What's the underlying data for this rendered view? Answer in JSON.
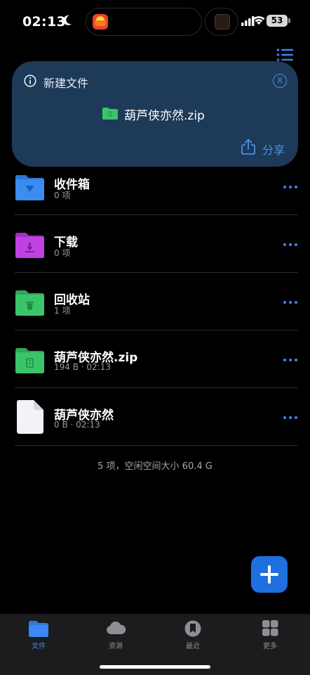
{
  "status_bar": {
    "time": "02:13",
    "battery": "53",
    "icons": [
      "moon-icon",
      "cellular-signal-icon",
      "wifi-icon",
      "battery-icon"
    ]
  },
  "toolbar": {
    "icon": "list-view-icon"
  },
  "banner": {
    "title": "新建文件",
    "file_name": "葫芦侠亦然.zip",
    "share_label": "分享",
    "icons": [
      "info-icon",
      "close-icon",
      "folder-icon",
      "share-icon"
    ],
    "background": "#1d3a58",
    "accent": "#4a90e8"
  },
  "files": [
    {
      "name": "收件箱",
      "meta": "0 项",
      "icon": "inbox-folder-icon",
      "color": "#3b8df0"
    },
    {
      "name": "下载",
      "meta": "0 项",
      "icon": "download-folder-icon",
      "color": "#c040e0"
    },
    {
      "name": "回收站",
      "meta": "1 项",
      "icon": "trash-folder-icon",
      "color": "#3cc46a"
    },
    {
      "name": "葫芦侠亦然.zip",
      "meta": "194 B · 02:13",
      "icon": "zip-folder-icon",
      "color": "#3cc46a"
    },
    {
      "name": "葫芦侠亦然",
      "meta": "0 B · 02:13",
      "icon": "document-icon",
      "color": "#f2f2f7"
    }
  ],
  "summary": "5 项，空闲空间大小 60.4 G",
  "tabs": [
    {
      "label": "文件",
      "icon": "folder-icon",
      "active": true
    },
    {
      "label": "资源",
      "icon": "cloud-icon",
      "active": false
    },
    {
      "label": "最近",
      "icon": "bookmark-icon",
      "active": false
    },
    {
      "label": "更多",
      "icon": "grid-icon",
      "active": false
    }
  ],
  "accent_color": "#3a87f5"
}
